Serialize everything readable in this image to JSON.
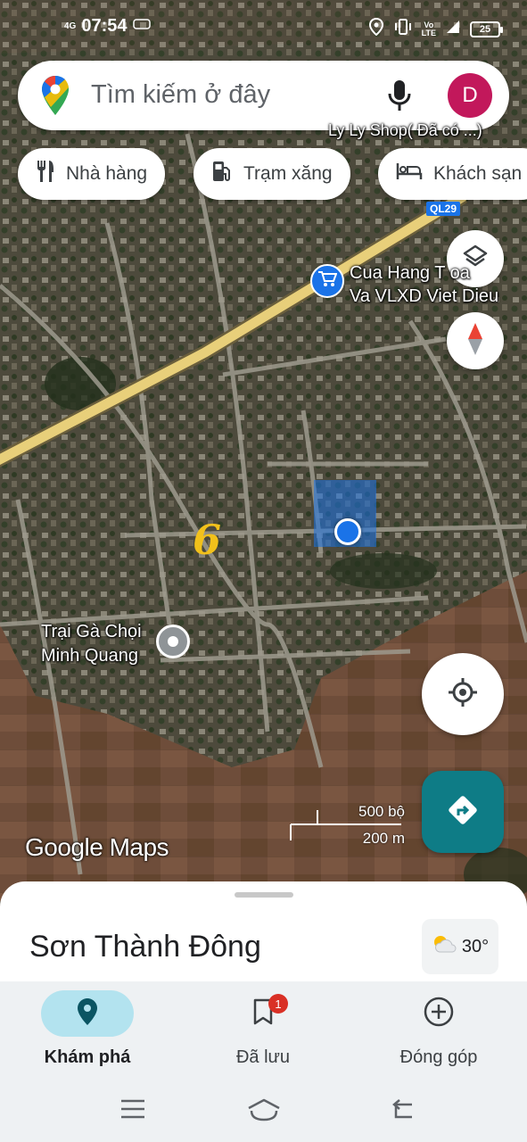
{
  "status_bar": {
    "time": "07:54",
    "network_small": "4G",
    "volte": "Vo\nLTE",
    "battery": "25"
  },
  "search": {
    "placeholder": "Tìm kiếm ở đây",
    "avatar_letter": "D"
  },
  "chips": [
    {
      "label": "Nhà hàng",
      "icon": "restaurant-icon"
    },
    {
      "label": "Trạm xăng",
      "icon": "gas-station-icon"
    },
    {
      "label": "Khách sạn",
      "icon": "hotel-icon"
    }
  ],
  "map": {
    "road_shield": "QL29",
    "top_place_partial": "Ly Ly Shop( Đã có ...)",
    "shop_label_line1": "Cua Hang T    oa",
    "shop_label_line2": "Va VLXD Viet Dieu",
    "poi_label_line1": "Trại Gà Chọi",
    "poi_label_line2": "Minh Quang",
    "handwritten_mark": "6",
    "scale_imperial": "500 bộ",
    "scale_metric": "200 m",
    "logo": "Google Maps",
    "colors": {
      "my_location": "#1a73e8",
      "highway": "#e8cf7a",
      "directions": "#0e7c86"
    }
  },
  "sheet": {
    "title": "Sơn Thành Đông",
    "weather_temp": "30°",
    "weather_icon": "partly-cloudy-icon"
  },
  "bottom_nav": [
    {
      "label": "Khám phá",
      "icon": "explore-pin-icon",
      "active": true
    },
    {
      "label": "Đã lưu",
      "icon": "bookmark-icon",
      "badge": "1"
    },
    {
      "label": "Đóng góp",
      "icon": "add-circle-icon"
    }
  ]
}
